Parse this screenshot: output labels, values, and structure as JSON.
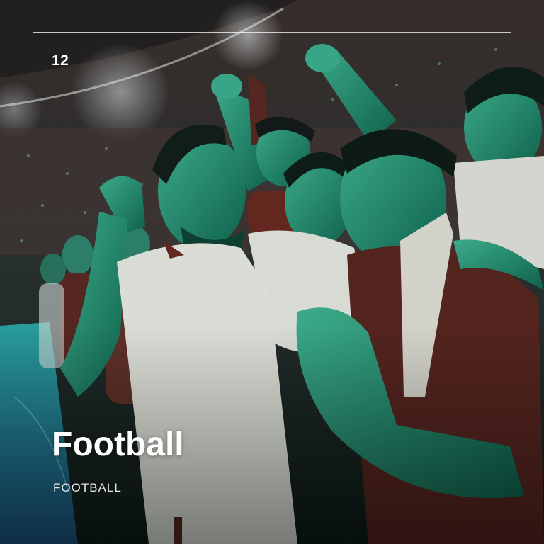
{
  "card": {
    "number": "12",
    "title": "Football",
    "subtitle": "FOOTBALL"
  },
  "photo": {
    "subject": "celebrating-football-fans-image",
    "colors": {
      "tint": "#1f8a6e",
      "kit_white": "#e9e1da",
      "kit_maroon": "#6a1f1a",
      "stadium_dark": "#3a2424",
      "pitch": "#1d5f8a"
    }
  }
}
